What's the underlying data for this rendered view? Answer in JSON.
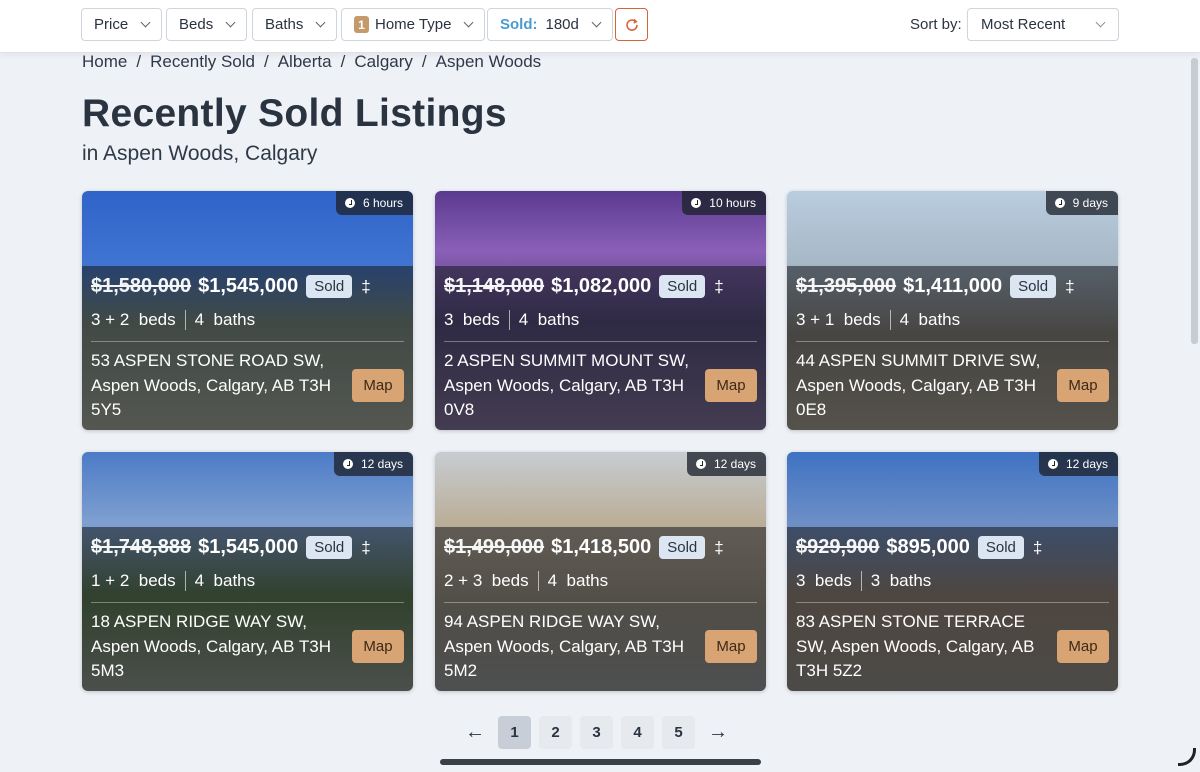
{
  "filters": {
    "price_label": "Price",
    "beds_label": "Beds",
    "baths_label": "Baths",
    "home_type_count": "1",
    "home_type_label": "Home Type",
    "sold_label": "Sold:",
    "sold_value": "180d"
  },
  "sort": {
    "label": "Sort by:",
    "value": "Most Recent"
  },
  "breadcrumb": [
    "Home",
    "Recently Sold",
    "Alberta",
    "Calgary",
    "Aspen Woods"
  ],
  "breadcrumb_sep": "/",
  "page": {
    "title": "Recently Sold Listings",
    "subtitle": "in Aspen Woods, Calgary"
  },
  "listing_common": {
    "sold_tag": "Sold",
    "dagger": "‡",
    "beds_word": "beds",
    "baths_word": "baths",
    "map_label": "Map"
  },
  "listings": [
    {
      "time": "6 hours",
      "list_price": "$1,580,000",
      "sold_price": "$1,545,000",
      "beds": "3 + 2",
      "baths": "4",
      "address": "53 ASPEN STONE ROAD SW, Aspen Woods, Calgary, AB T3H 5Y5"
    },
    {
      "time": "10 hours",
      "list_price": "$1,148,000",
      "sold_price": "$1,082,000",
      "beds": "3",
      "baths": "4",
      "address": "2 ASPEN SUMMIT MOUNT SW, Aspen Woods, Calgary, AB T3H 0V8"
    },
    {
      "time": "9 days",
      "list_price": "$1,395,000",
      "sold_price": "$1,411,000",
      "beds": "3 + 1",
      "baths": "4",
      "address": "44 ASPEN SUMMIT DRIVE SW, Aspen Woods, Calgary, AB T3H 0E8"
    },
    {
      "time": "12 days",
      "list_price": "$1,748,888",
      "sold_price": "$1,545,000",
      "beds": "1 + 2",
      "baths": "4",
      "address": "18 ASPEN RIDGE WAY SW, Aspen Woods, Calgary, AB T3H 5M3"
    },
    {
      "time": "12 days",
      "list_price": "$1,499,000",
      "sold_price": "$1,418,500",
      "beds": "2 + 3",
      "baths": "4",
      "address": "94 ASPEN RIDGE WAY SW, Aspen Woods, Calgary, AB T3H 5M2"
    },
    {
      "time": "12 days",
      "list_price": "$929,900",
      "sold_price": "$895,000",
      "beds": "3",
      "baths": "3",
      "address": "83 ASPEN STONE TERRACE SW, Aspen Woods, Calgary, AB T3H 5Z2"
    }
  ],
  "pagination": {
    "prev": "←",
    "next": "→",
    "pages": [
      "1",
      "2",
      "3",
      "4",
      "5"
    ],
    "current": "1"
  },
  "colors": {
    "accent": "#c59a6a",
    "map_button": "#d9a473",
    "sold_blue": "#4a9bd1",
    "refresh_border": "#d8623a"
  },
  "icons": [
    "chevron-down-icon",
    "refresh-icon",
    "clock-icon",
    "arrow-left-icon",
    "arrow-right-icon"
  ]
}
